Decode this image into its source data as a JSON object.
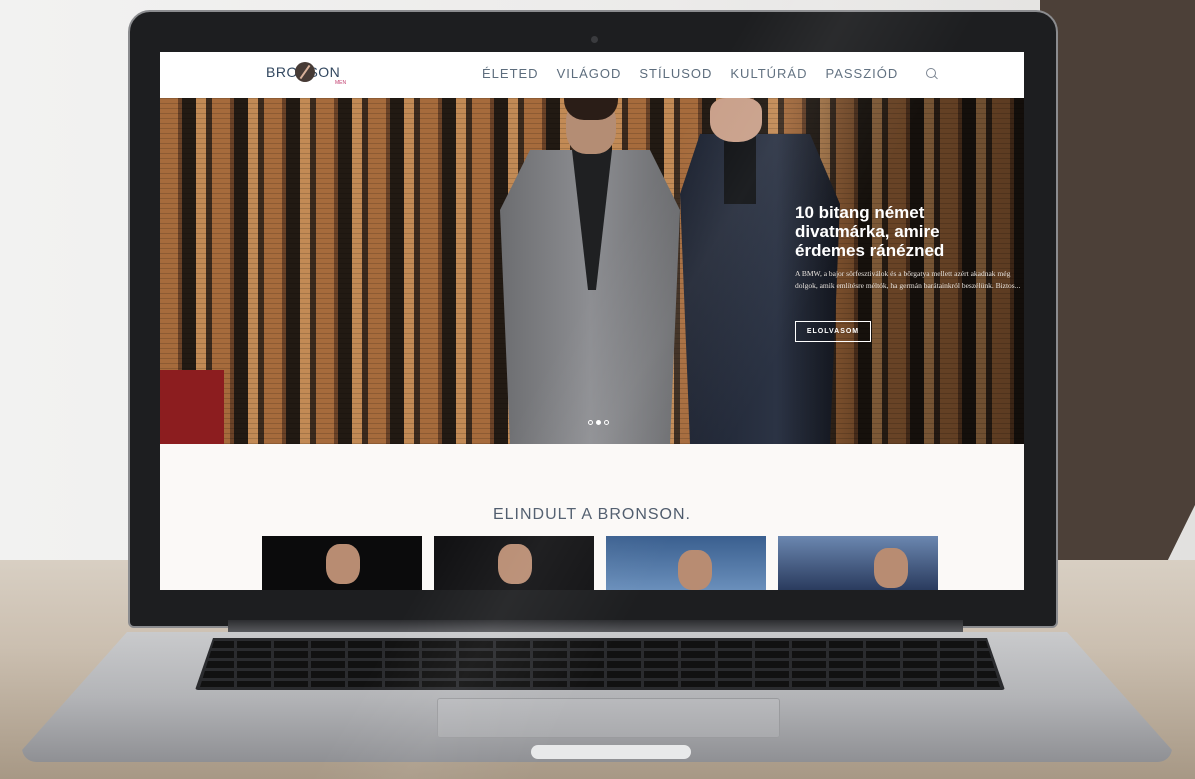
{
  "site": {
    "logo_text": "BRONSON",
    "logo_sub": "MEN"
  },
  "nav": {
    "items": [
      "ÉLETED",
      "VILÁGOD",
      "STÍLUSOD",
      "KULTÚRÁD",
      "PASSZIÓD"
    ],
    "search_icon": "search-icon"
  },
  "hero": {
    "title": "10 bitang német divatmárka, amire érdemes ránézned",
    "text": "A BMW, a bajor sörfesztiválok és a bőrgatya mellett azért akadnak még dolgok, amik említésre méltók, ha germán barátainkról beszélünk. Biztos...",
    "button": "ELOLVASOM",
    "slide_count": 3,
    "active_slide": 2
  },
  "section": {
    "title": "ELINDULT A BRONSON."
  },
  "colors": {
    "nav_text": "#5d6d7d",
    "logo_accent": "#c23c6d",
    "page_bg": "#fbf9f7"
  }
}
